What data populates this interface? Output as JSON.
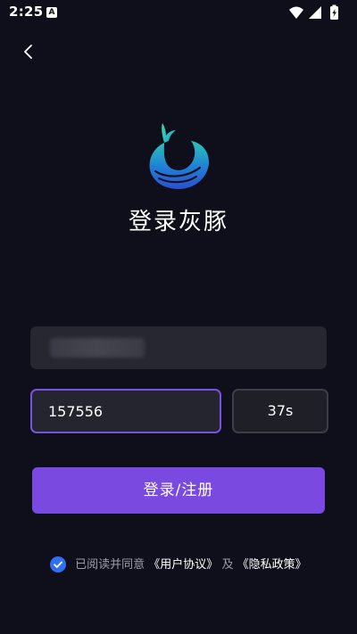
{
  "status_bar": {
    "time": "2:25",
    "app_icon_letter": "A"
  },
  "header": {
    "title": "登录灰豚"
  },
  "form": {
    "phone_value_hidden": true,
    "code_value": "157556",
    "countdown_label": "37s",
    "submit_label": "登录/注册"
  },
  "agreement": {
    "checked": true,
    "prefix": "已阅读并同意",
    "user_agreement": "《用户协议》",
    "connector": "及",
    "privacy_policy": "《隐私政策》"
  },
  "colors": {
    "background": "#0e0f1a",
    "accent": "#7a4ae0",
    "input_bg": "#262730",
    "checkbox": "#2f6ff0",
    "muted_text": "#9c9da8"
  },
  "icons": [
    "back-chevron-icon",
    "wifi-icon",
    "signal-icon",
    "battery-icon",
    "whale-logo"
  ]
}
